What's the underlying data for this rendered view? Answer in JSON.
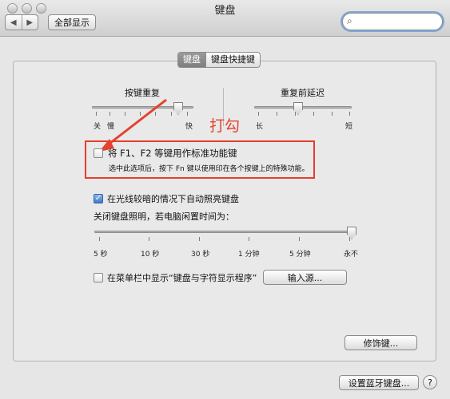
{
  "window": {
    "title": "键盘"
  },
  "toolbar": {
    "back_icon": "◀",
    "forward_icon": "▶",
    "show_all": "全部显示",
    "search_value": ""
  },
  "tabs": [
    {
      "label": "键盘"
    },
    {
      "label": "键盘快捷键"
    }
  ],
  "key_repeat": {
    "label": "按键重复",
    "slow": "关",
    "slower": "慢",
    "fast": "快",
    "level": 0.85
  },
  "repeat_delay": {
    "label": "重复前延迟",
    "long": "长",
    "short": "短",
    "level": 0.45
  },
  "fn_keys": {
    "label": "将 F1、F2 等键用作标准功能键",
    "description": "选中此选项后，按下 Fn 键以使用印在各个按键上的特殊功能。",
    "checked": false
  },
  "annotation": {
    "text": "打勾",
    "color": "#e4432f"
  },
  "backlight": {
    "label": "在光线较暗的情况下自动照亮键盘",
    "checked": true,
    "off_label": "关闭键盘照明，若电脑闲置时间为：",
    "ticks": [
      "5 秒",
      "10 秒",
      "30 秒",
      "1 分钟",
      "5 分钟",
      "永不"
    ],
    "selected_index": 5
  },
  "menubar_option": {
    "label": "在菜单栏中显示“键盘与字符显示程序”",
    "checked": false,
    "input_sources_button": "输入源..."
  },
  "modifier_button": "修饰键...",
  "bluetooth_button": "设置蓝牙键盘...",
  "help": "?"
}
